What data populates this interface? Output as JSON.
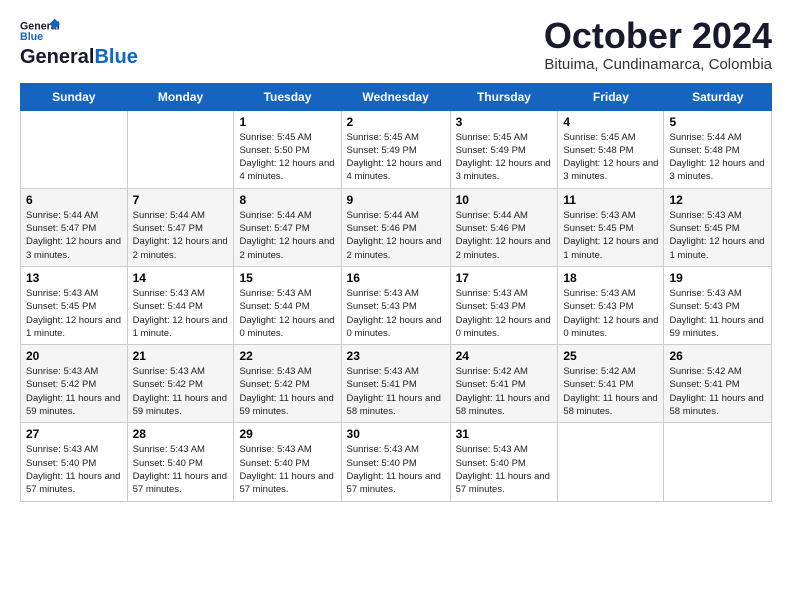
{
  "header": {
    "logo_line1": "General",
    "logo_line2": "Blue",
    "month": "October 2024",
    "location": "Bituima, Cundinamarca, Colombia"
  },
  "days_of_week": [
    "Sunday",
    "Monday",
    "Tuesday",
    "Wednesday",
    "Thursday",
    "Friday",
    "Saturday"
  ],
  "weeks": [
    [
      {
        "day": "",
        "info": ""
      },
      {
        "day": "",
        "info": ""
      },
      {
        "day": "1",
        "info": "Sunrise: 5:45 AM\nSunset: 5:50 PM\nDaylight: 12 hours and 4 minutes."
      },
      {
        "day": "2",
        "info": "Sunrise: 5:45 AM\nSunset: 5:49 PM\nDaylight: 12 hours and 4 minutes."
      },
      {
        "day": "3",
        "info": "Sunrise: 5:45 AM\nSunset: 5:49 PM\nDaylight: 12 hours and 3 minutes."
      },
      {
        "day": "4",
        "info": "Sunrise: 5:45 AM\nSunset: 5:48 PM\nDaylight: 12 hours and 3 minutes."
      },
      {
        "day": "5",
        "info": "Sunrise: 5:44 AM\nSunset: 5:48 PM\nDaylight: 12 hours and 3 minutes."
      }
    ],
    [
      {
        "day": "6",
        "info": "Sunrise: 5:44 AM\nSunset: 5:47 PM\nDaylight: 12 hours and 3 minutes."
      },
      {
        "day": "7",
        "info": "Sunrise: 5:44 AM\nSunset: 5:47 PM\nDaylight: 12 hours and 2 minutes."
      },
      {
        "day": "8",
        "info": "Sunrise: 5:44 AM\nSunset: 5:47 PM\nDaylight: 12 hours and 2 minutes."
      },
      {
        "day": "9",
        "info": "Sunrise: 5:44 AM\nSunset: 5:46 PM\nDaylight: 12 hours and 2 minutes."
      },
      {
        "day": "10",
        "info": "Sunrise: 5:44 AM\nSunset: 5:46 PM\nDaylight: 12 hours and 2 minutes."
      },
      {
        "day": "11",
        "info": "Sunrise: 5:43 AM\nSunset: 5:45 PM\nDaylight: 12 hours and 1 minute."
      },
      {
        "day": "12",
        "info": "Sunrise: 5:43 AM\nSunset: 5:45 PM\nDaylight: 12 hours and 1 minute."
      }
    ],
    [
      {
        "day": "13",
        "info": "Sunrise: 5:43 AM\nSunset: 5:45 PM\nDaylight: 12 hours and 1 minute."
      },
      {
        "day": "14",
        "info": "Sunrise: 5:43 AM\nSunset: 5:44 PM\nDaylight: 12 hours and 1 minute."
      },
      {
        "day": "15",
        "info": "Sunrise: 5:43 AM\nSunset: 5:44 PM\nDaylight: 12 hours and 0 minutes."
      },
      {
        "day": "16",
        "info": "Sunrise: 5:43 AM\nSunset: 5:43 PM\nDaylight: 12 hours and 0 minutes."
      },
      {
        "day": "17",
        "info": "Sunrise: 5:43 AM\nSunset: 5:43 PM\nDaylight: 12 hours and 0 minutes."
      },
      {
        "day": "18",
        "info": "Sunrise: 5:43 AM\nSunset: 5:43 PM\nDaylight: 12 hours and 0 minutes."
      },
      {
        "day": "19",
        "info": "Sunrise: 5:43 AM\nSunset: 5:43 PM\nDaylight: 11 hours and 59 minutes."
      }
    ],
    [
      {
        "day": "20",
        "info": "Sunrise: 5:43 AM\nSunset: 5:42 PM\nDaylight: 11 hours and 59 minutes."
      },
      {
        "day": "21",
        "info": "Sunrise: 5:43 AM\nSunset: 5:42 PM\nDaylight: 11 hours and 59 minutes."
      },
      {
        "day": "22",
        "info": "Sunrise: 5:43 AM\nSunset: 5:42 PM\nDaylight: 11 hours and 59 minutes."
      },
      {
        "day": "23",
        "info": "Sunrise: 5:43 AM\nSunset: 5:41 PM\nDaylight: 11 hours and 58 minutes."
      },
      {
        "day": "24",
        "info": "Sunrise: 5:42 AM\nSunset: 5:41 PM\nDaylight: 11 hours and 58 minutes."
      },
      {
        "day": "25",
        "info": "Sunrise: 5:42 AM\nSunset: 5:41 PM\nDaylight: 11 hours and 58 minutes."
      },
      {
        "day": "26",
        "info": "Sunrise: 5:42 AM\nSunset: 5:41 PM\nDaylight: 11 hours and 58 minutes."
      }
    ],
    [
      {
        "day": "27",
        "info": "Sunrise: 5:43 AM\nSunset: 5:40 PM\nDaylight: 11 hours and 57 minutes."
      },
      {
        "day": "28",
        "info": "Sunrise: 5:43 AM\nSunset: 5:40 PM\nDaylight: 11 hours and 57 minutes."
      },
      {
        "day": "29",
        "info": "Sunrise: 5:43 AM\nSunset: 5:40 PM\nDaylight: 11 hours and 57 minutes."
      },
      {
        "day": "30",
        "info": "Sunrise: 5:43 AM\nSunset: 5:40 PM\nDaylight: 11 hours and 57 minutes."
      },
      {
        "day": "31",
        "info": "Sunrise: 5:43 AM\nSunset: 5:40 PM\nDaylight: 11 hours and 57 minutes."
      },
      {
        "day": "",
        "info": ""
      },
      {
        "day": "",
        "info": ""
      }
    ]
  ]
}
